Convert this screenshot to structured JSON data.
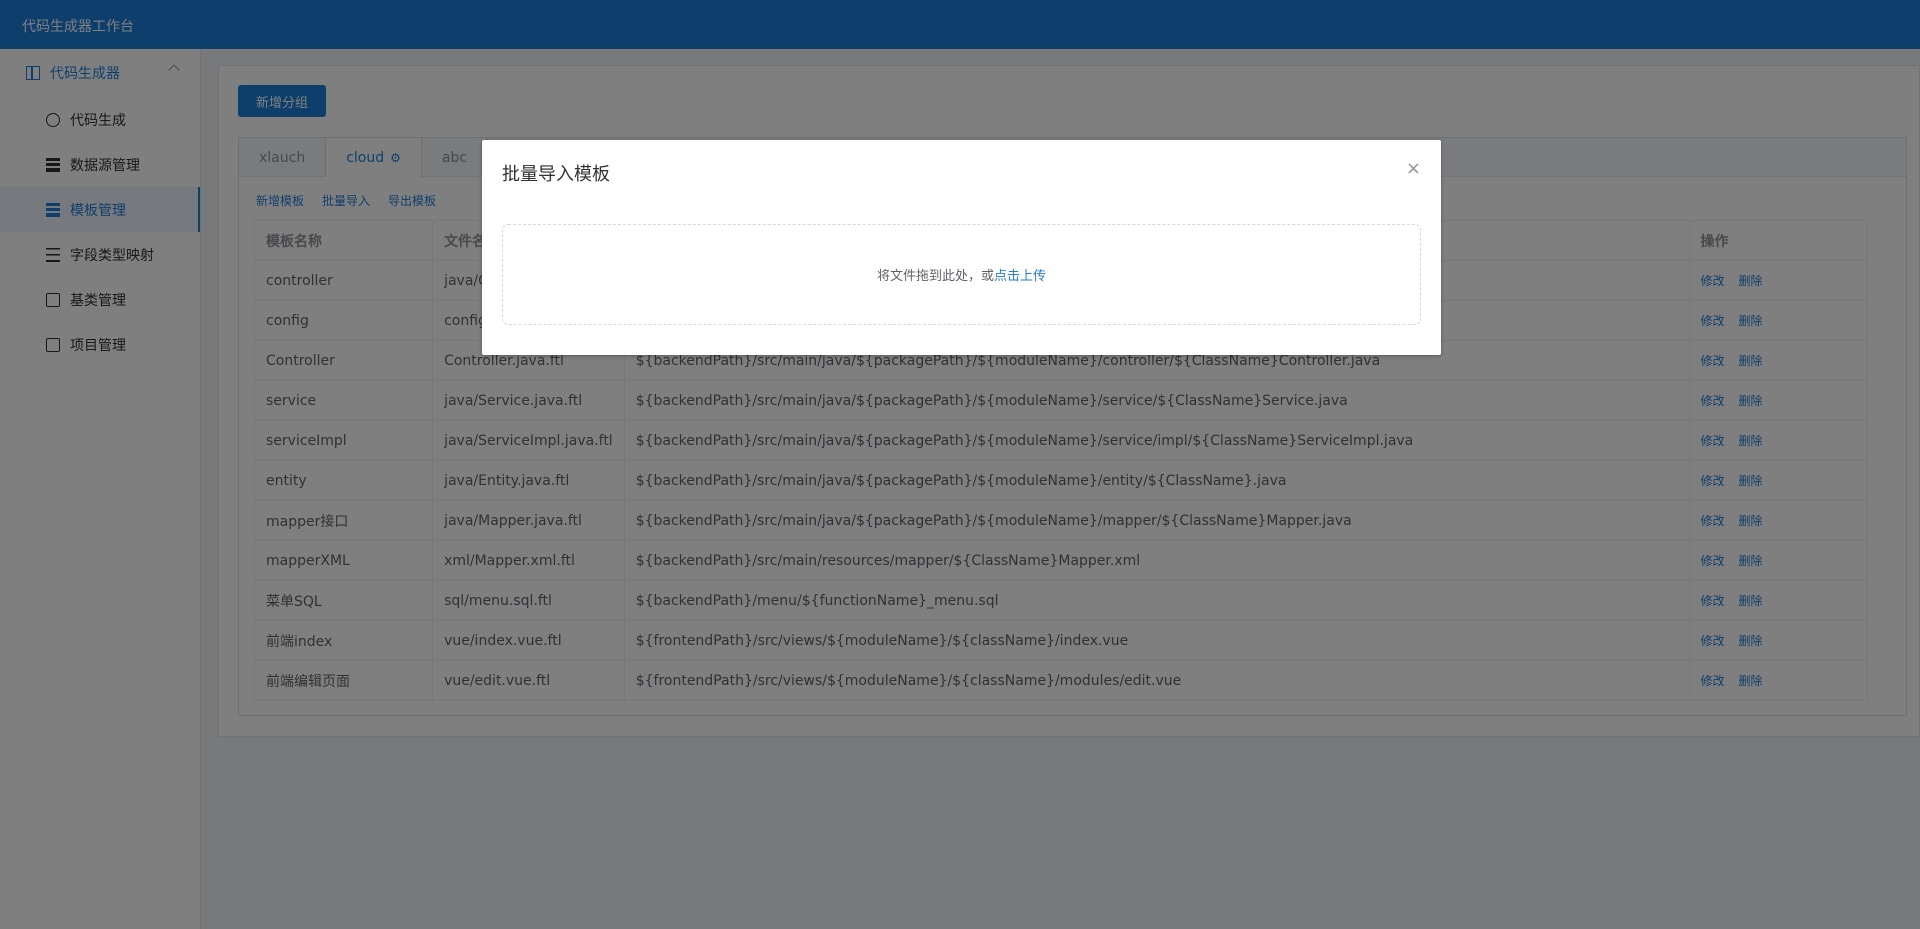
{
  "app": {
    "title": "代码生成器工作台"
  },
  "sidebar": {
    "group_label": "代码生成器",
    "items": [
      {
        "label": "代码生成",
        "icon": "pointer-icon"
      },
      {
        "label": "数据源管理",
        "icon": "database-icon"
      },
      {
        "label": "模板管理",
        "icon": "template-icon"
      },
      {
        "label": "字段类型映射",
        "icon": "list-icon"
      },
      {
        "label": "基类管理",
        "icon": "hierarchy-icon"
      },
      {
        "label": "项目管理",
        "icon": "edit-icon"
      }
    ]
  },
  "toolbar": {
    "add_group_label": "新增分组"
  },
  "tabs": [
    {
      "label": "xlauch"
    },
    {
      "label": "cloud"
    },
    {
      "label": "abc"
    }
  ],
  "actions": {
    "add": "新增模板",
    "import": "批量导入",
    "export": "导出模板"
  },
  "table": {
    "headers": [
      "模板名称",
      "文件名",
      "",
      "操作"
    ],
    "op_edit": "修改",
    "op_delete": "删除",
    "rows": [
      {
        "name": "controller",
        "file": "java/Controller.java.ftl",
        "path": ""
      },
      {
        "name": "config",
        "file": "config",
        "path": ""
      },
      {
        "name": "Controller",
        "file": "Controller.java.ftl",
        "path": "${backendPath}/src/main/java/${packagePath}/${moduleName}/controller/${ClassName}Controller.java"
      },
      {
        "name": "service",
        "file": "java/Service.java.ftl",
        "path": "${backendPath}/src/main/java/${packagePath}/${moduleName}/service/${ClassName}Service.java"
      },
      {
        "name": "serviceImpl",
        "file": "java/ServiceImpl.java.ftl",
        "path": "${backendPath}/src/main/java/${packagePath}/${moduleName}/service/impl/${ClassName}ServiceImpl.java"
      },
      {
        "name": "entity",
        "file": "java/Entity.java.ftl",
        "path": "${backendPath}/src/main/java/${packagePath}/${moduleName}/entity/${ClassName}.java"
      },
      {
        "name": "mapper接口",
        "file": "java/Mapper.java.ftl",
        "path": "${backendPath}/src/main/java/${packagePath}/${moduleName}/mapper/${ClassName}Mapper.java"
      },
      {
        "name": "mapperXML",
        "file": "xml/Mapper.xml.ftl",
        "path": "${backendPath}/src/main/resources/mapper/${ClassName}Mapper.xml"
      },
      {
        "name": "菜单SQL",
        "file": "sql/menu.sql.ftl",
        "path": "${backendPath}/menu/${functionName}_menu.sql"
      },
      {
        "name": "前端index",
        "file": "vue/index.vue.ftl",
        "path": "${frontendPath}/src/views/${moduleName}/${className}/index.vue"
      },
      {
        "name": "前端编辑页面",
        "file": "vue/edit.vue.ftl",
        "path": "${frontendPath}/src/views/${moduleName}/${className}/modules/edit.vue"
      }
    ]
  },
  "dialog": {
    "title": "批量导入模板",
    "drop_text": "将文件拖到此处，或",
    "upload_link": "点击上传",
    "close_glyph": "×"
  },
  "colors": {
    "primary": "#1d7fd8",
    "topbar": "#1d7fd8"
  }
}
